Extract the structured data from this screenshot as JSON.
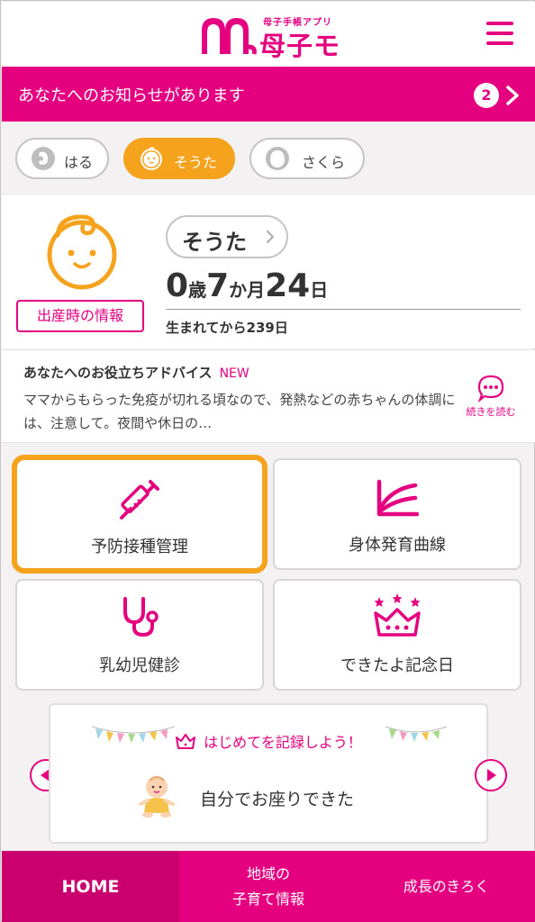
{
  "app": {
    "logo_subtitle": "母子手帳アプリ",
    "logo_title": "母子モ",
    "brand_color": "#e5007f",
    "accent_color": "#f5a21c"
  },
  "notice": {
    "text": "あなたへのお知らせがあります",
    "count": "2"
  },
  "children": [
    {
      "name": "はる",
      "icon": "fetus-icon",
      "active": false
    },
    {
      "name": "そうた",
      "icon": "baby-boy-icon",
      "active": true
    },
    {
      "name": "さくら",
      "icon": "girl-icon",
      "active": false
    }
  ],
  "profile": {
    "name": "そうた",
    "birth_info_label": "出産時の情報",
    "age_years": "0",
    "age_years_unit": "歳",
    "age_months": "7",
    "age_months_unit": "か月",
    "age_days": "24",
    "age_days_unit": "日",
    "days_since_birth": "生まれてから239日"
  },
  "advice": {
    "title": "あなたへのお役立ちアドバイス",
    "new_badge": "NEW",
    "body": "ママからもらった免疫が切れる頃なので、発熱などの赤ちゃんの体調には、注意して。夜間や休日の…",
    "read_more": "続きを読む"
  },
  "features": [
    {
      "label": "予防接種管理",
      "icon": "syringe-icon"
    },
    {
      "label": "身体発育曲線",
      "icon": "growth-curve-icon"
    },
    {
      "label": "乳幼児健診",
      "icon": "stethoscope-icon"
    },
    {
      "label": "できたよ記念日",
      "icon": "crown-icon"
    }
  ],
  "milestone": {
    "heading": "はじめてを記録しよう！",
    "item": "自分でお座りできた"
  },
  "bottom_nav": {
    "home": "HOME",
    "local_line1": "地域の",
    "local_line2": "子育て情報",
    "growth": "成長のきろく"
  }
}
